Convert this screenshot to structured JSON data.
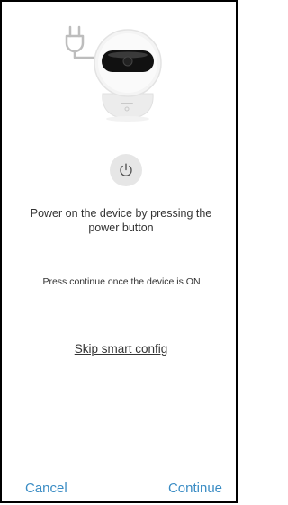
{
  "hero": {
    "plug_icon": "plug-icon",
    "device_image": "camera-device-image"
  },
  "power_button": {
    "icon": "power-icon",
    "color": "#555555"
  },
  "instruction": "Power on the device by pressing the power button",
  "hint": "Press continue once the device is ON",
  "skip_link": "Skip smart config",
  "footer": {
    "cancel_label": "Cancel",
    "continue_label": "Continue",
    "accent_color": "#3a8cc4"
  }
}
